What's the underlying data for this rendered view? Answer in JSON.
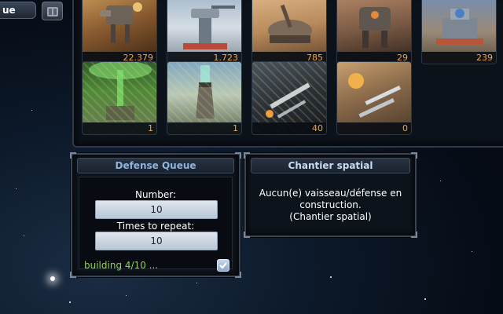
{
  "toolbar": {
    "tab_label": "ue",
    "icon": "crate-icon"
  },
  "grid": {
    "row1": [
      {
        "name": "defense-mech-walker",
        "count": "22.379"
      },
      {
        "name": "defense-turret-tower",
        "count": "1.723"
      },
      {
        "name": "defense-dome-cannon",
        "count": "785"
      },
      {
        "name": "defense-heavy-walker",
        "count": "29"
      },
      {
        "name": "defense-fortress",
        "count": "239"
      }
    ],
    "row2": [
      {
        "name": "defense-shield-beacon",
        "count": "1"
      },
      {
        "name": "defense-shield-tower",
        "count": "1"
      },
      {
        "name": "missile-strike-battery",
        "count": "40"
      },
      {
        "name": "missile-barrage-battery",
        "count": "0"
      }
    ]
  },
  "defense_queue": {
    "title": "Defense Queue",
    "number_label": "Number:",
    "number_value": "10",
    "repeat_label": "Times to repeat:",
    "repeat_value": "10",
    "status": "building 4/10 ...",
    "checkbox_checked": true
  },
  "shipyard": {
    "title": "Chantier spatial",
    "message_line1": "Aucun(e) vaisseau/défense en",
    "message_line2": "construction.",
    "message_line3": "(Chantier spatial)"
  },
  "colors": {
    "count_orange": "#f2a341",
    "status_green": "#8ed34a",
    "header_blue": "#8fb4de"
  }
}
